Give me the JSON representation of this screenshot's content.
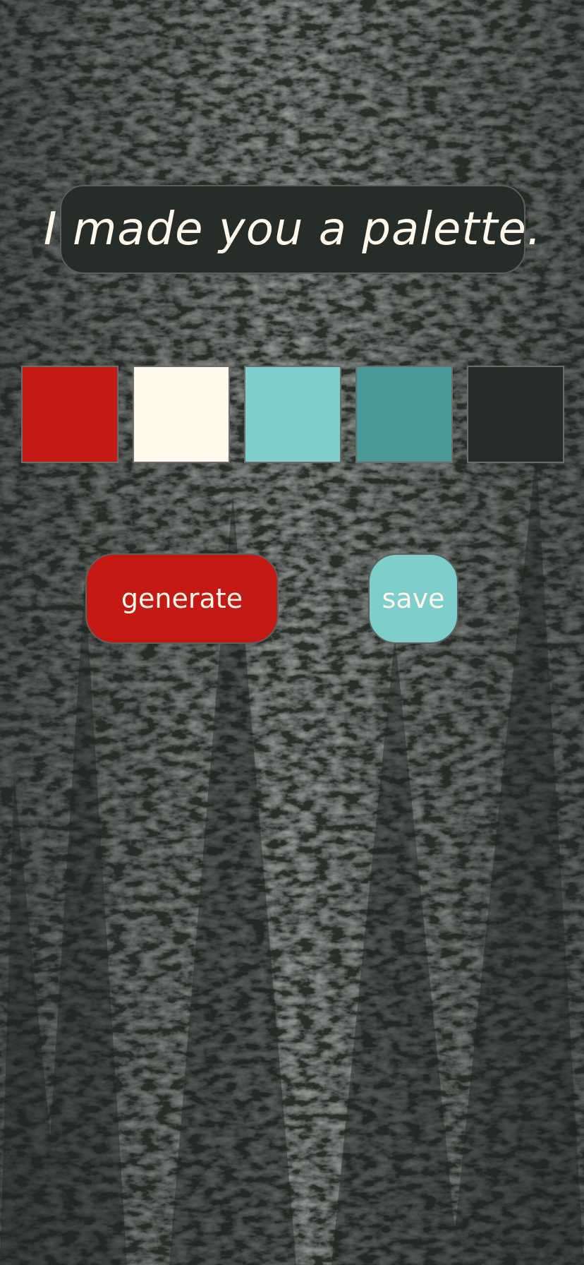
{
  "app": {
    "title": "I made you a palette."
  },
  "palette": {
    "colors": [
      "#c41915",
      "#fff9ec",
      "#7ecfcc",
      "#4a9a9a",
      "#262c28"
    ]
  },
  "buttons": {
    "generate_label": "generate",
    "save_label": "save"
  },
  "theme": {
    "background": "#2a302c",
    "title_box_bg": "#262c28",
    "title_text_color": "#fff9ec",
    "generate_bg": "#c41915",
    "generate_text": "#fff9ec",
    "save_bg": "#7ecfcc",
    "save_text": "#fff9ec"
  },
  "background_image": {
    "subject": "forest-of-conifer-trees-photo"
  }
}
